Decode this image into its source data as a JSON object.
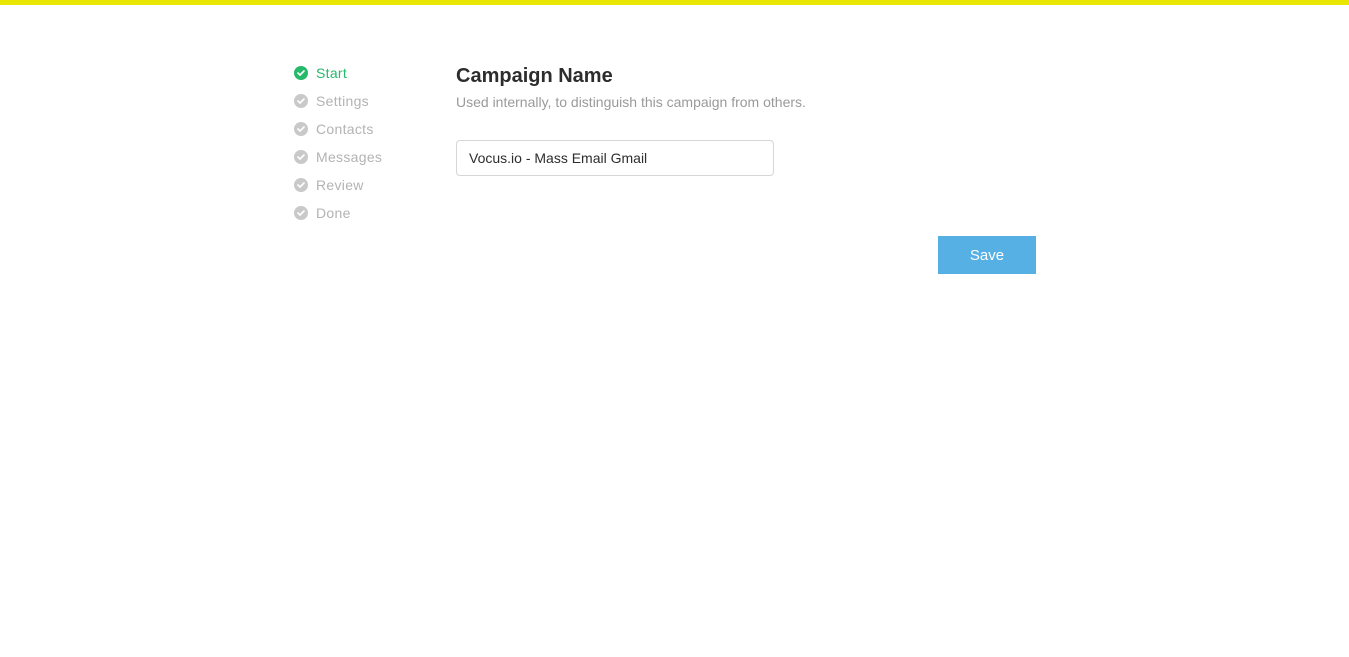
{
  "sidebar": {
    "steps": [
      {
        "label": "Start",
        "active": true
      },
      {
        "label": "Settings",
        "active": false
      },
      {
        "label": "Contacts",
        "active": false
      },
      {
        "label": "Messages",
        "active": false
      },
      {
        "label": "Review",
        "active": false
      },
      {
        "label": "Done",
        "active": false
      }
    ]
  },
  "main": {
    "title": "Campaign Name",
    "subtitle": "Used internally, to distinguish this campaign from others.",
    "campaign_name_value": "Vocus.io - Mass Email Gmail",
    "save_label": "Save"
  }
}
